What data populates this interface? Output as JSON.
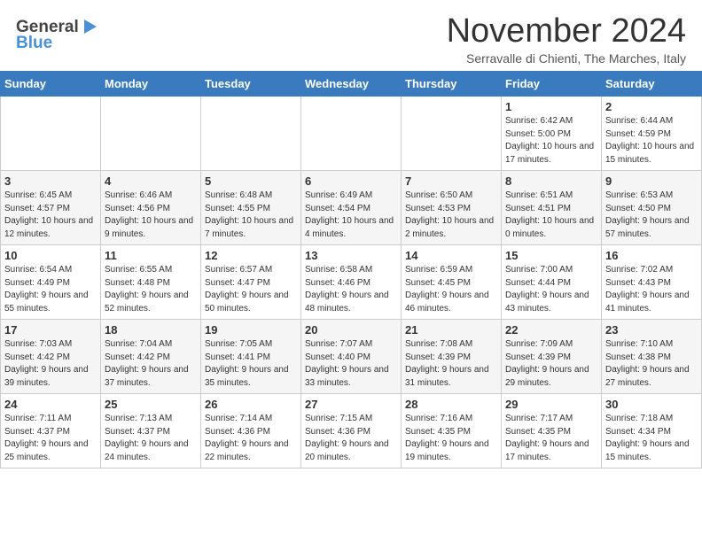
{
  "header": {
    "logo_general": "General",
    "logo_blue": "Blue",
    "month": "November 2024",
    "location": "Serravalle di Chienti, The Marches, Italy"
  },
  "weekdays": [
    "Sunday",
    "Monday",
    "Tuesday",
    "Wednesday",
    "Thursday",
    "Friday",
    "Saturday"
  ],
  "weeks": [
    [
      {
        "day": "",
        "info": ""
      },
      {
        "day": "",
        "info": ""
      },
      {
        "day": "",
        "info": ""
      },
      {
        "day": "",
        "info": ""
      },
      {
        "day": "",
        "info": ""
      },
      {
        "day": "1",
        "info": "Sunrise: 6:42 AM\nSunset: 5:00 PM\nDaylight: 10 hours and 17 minutes."
      },
      {
        "day": "2",
        "info": "Sunrise: 6:44 AM\nSunset: 4:59 PM\nDaylight: 10 hours and 15 minutes."
      }
    ],
    [
      {
        "day": "3",
        "info": "Sunrise: 6:45 AM\nSunset: 4:57 PM\nDaylight: 10 hours and 12 minutes."
      },
      {
        "day": "4",
        "info": "Sunrise: 6:46 AM\nSunset: 4:56 PM\nDaylight: 10 hours and 9 minutes."
      },
      {
        "day": "5",
        "info": "Sunrise: 6:48 AM\nSunset: 4:55 PM\nDaylight: 10 hours and 7 minutes."
      },
      {
        "day": "6",
        "info": "Sunrise: 6:49 AM\nSunset: 4:54 PM\nDaylight: 10 hours and 4 minutes."
      },
      {
        "day": "7",
        "info": "Sunrise: 6:50 AM\nSunset: 4:53 PM\nDaylight: 10 hours and 2 minutes."
      },
      {
        "day": "8",
        "info": "Sunrise: 6:51 AM\nSunset: 4:51 PM\nDaylight: 10 hours and 0 minutes."
      },
      {
        "day": "9",
        "info": "Sunrise: 6:53 AM\nSunset: 4:50 PM\nDaylight: 9 hours and 57 minutes."
      }
    ],
    [
      {
        "day": "10",
        "info": "Sunrise: 6:54 AM\nSunset: 4:49 PM\nDaylight: 9 hours and 55 minutes."
      },
      {
        "day": "11",
        "info": "Sunrise: 6:55 AM\nSunset: 4:48 PM\nDaylight: 9 hours and 52 minutes."
      },
      {
        "day": "12",
        "info": "Sunrise: 6:57 AM\nSunset: 4:47 PM\nDaylight: 9 hours and 50 minutes."
      },
      {
        "day": "13",
        "info": "Sunrise: 6:58 AM\nSunset: 4:46 PM\nDaylight: 9 hours and 48 minutes."
      },
      {
        "day": "14",
        "info": "Sunrise: 6:59 AM\nSunset: 4:45 PM\nDaylight: 9 hours and 46 minutes."
      },
      {
        "day": "15",
        "info": "Sunrise: 7:00 AM\nSunset: 4:44 PM\nDaylight: 9 hours and 43 minutes."
      },
      {
        "day": "16",
        "info": "Sunrise: 7:02 AM\nSunset: 4:43 PM\nDaylight: 9 hours and 41 minutes."
      }
    ],
    [
      {
        "day": "17",
        "info": "Sunrise: 7:03 AM\nSunset: 4:42 PM\nDaylight: 9 hours and 39 minutes."
      },
      {
        "day": "18",
        "info": "Sunrise: 7:04 AM\nSunset: 4:42 PM\nDaylight: 9 hours and 37 minutes."
      },
      {
        "day": "19",
        "info": "Sunrise: 7:05 AM\nSunset: 4:41 PM\nDaylight: 9 hours and 35 minutes."
      },
      {
        "day": "20",
        "info": "Sunrise: 7:07 AM\nSunset: 4:40 PM\nDaylight: 9 hours and 33 minutes."
      },
      {
        "day": "21",
        "info": "Sunrise: 7:08 AM\nSunset: 4:39 PM\nDaylight: 9 hours and 31 minutes."
      },
      {
        "day": "22",
        "info": "Sunrise: 7:09 AM\nSunset: 4:39 PM\nDaylight: 9 hours and 29 minutes."
      },
      {
        "day": "23",
        "info": "Sunrise: 7:10 AM\nSunset: 4:38 PM\nDaylight: 9 hours and 27 minutes."
      }
    ],
    [
      {
        "day": "24",
        "info": "Sunrise: 7:11 AM\nSunset: 4:37 PM\nDaylight: 9 hours and 25 minutes."
      },
      {
        "day": "25",
        "info": "Sunrise: 7:13 AM\nSunset: 4:37 PM\nDaylight: 9 hours and 24 minutes."
      },
      {
        "day": "26",
        "info": "Sunrise: 7:14 AM\nSunset: 4:36 PM\nDaylight: 9 hours and 22 minutes."
      },
      {
        "day": "27",
        "info": "Sunrise: 7:15 AM\nSunset: 4:36 PM\nDaylight: 9 hours and 20 minutes."
      },
      {
        "day": "28",
        "info": "Sunrise: 7:16 AM\nSunset: 4:35 PM\nDaylight: 9 hours and 19 minutes."
      },
      {
        "day": "29",
        "info": "Sunrise: 7:17 AM\nSunset: 4:35 PM\nDaylight: 9 hours and 17 minutes."
      },
      {
        "day": "30",
        "info": "Sunrise: 7:18 AM\nSunset: 4:34 PM\nDaylight: 9 hours and 15 minutes."
      }
    ]
  ]
}
